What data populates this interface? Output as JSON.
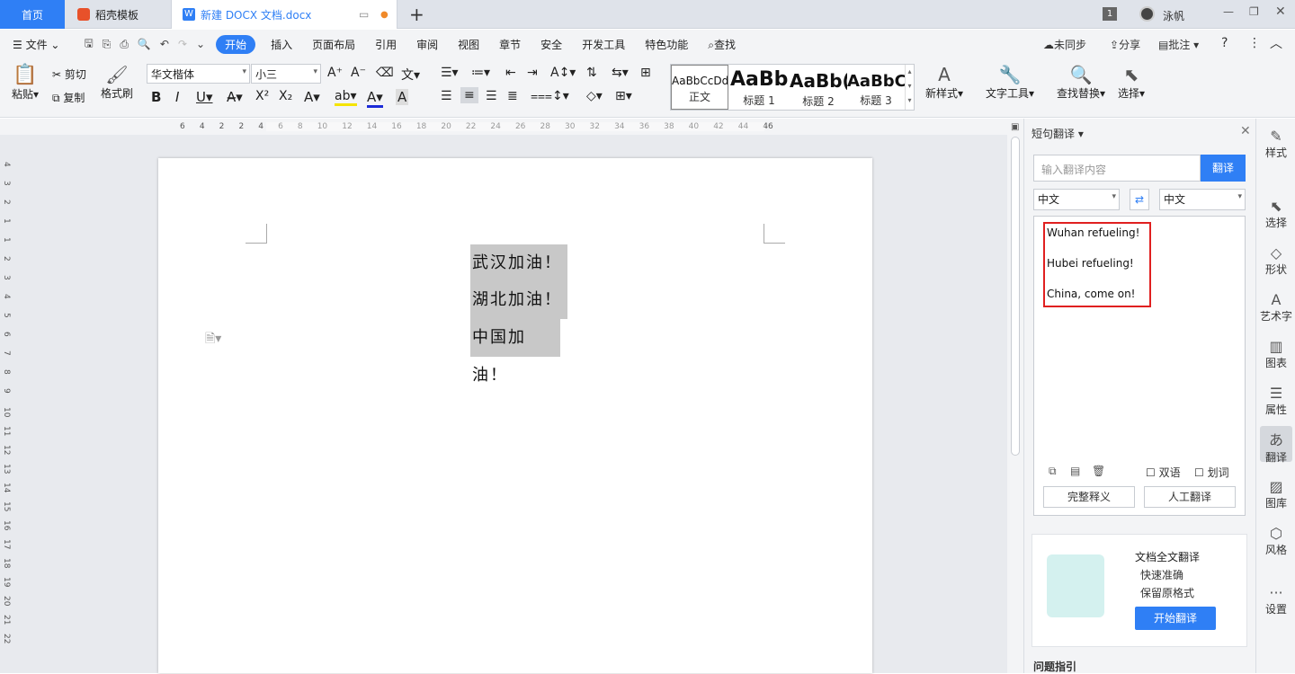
{
  "tabs": {
    "home": "首页",
    "template": "稻壳模板",
    "doc": "新建 DOCX 文档.docx",
    "user": "泳帆",
    "badge": "1"
  },
  "menu": {
    "file": "文件",
    "items": [
      "开始",
      "插入",
      "页面布局",
      "引用",
      "审阅",
      "视图",
      "章节",
      "安全",
      "开发工具",
      "特色功能",
      "查找"
    ],
    "sync": "未同步",
    "share": "分享",
    "comment": "批注"
  },
  "toolbar": {
    "paste": "粘贴",
    "cut": "剪切",
    "copy": "复制",
    "format_painter": "格式刷",
    "font": "华文楷体",
    "size": "小三",
    "styles": [
      {
        "preview": "AaBbCcDd",
        "label": "正文"
      },
      {
        "preview": "AaBb",
        "label": "标题 1"
      },
      {
        "preview": "AaBb(",
        "label": "标题 2"
      },
      {
        "preview": "AaBbC(",
        "label": "标题 3"
      }
    ],
    "new_style": "新样式",
    "text_tools": "文字工具",
    "find_replace": "查找替换",
    "select": "选择"
  },
  "ruler": {
    "top_marks": [
      "6",
      "4",
      "2",
      "2",
      "4",
      "6",
      "8",
      "10",
      "12",
      "14",
      "16",
      "18",
      "20",
      "22",
      "24",
      "26",
      "28",
      "30",
      "32",
      "34",
      "36",
      "38",
      "40",
      "42",
      "44",
      "46"
    ],
    "left_marks": [
      "4",
      "3",
      "2",
      "1",
      "1",
      "2",
      "3",
      "4",
      "5",
      "6",
      "7",
      "8",
      "9",
      "10",
      "11",
      "12",
      "13",
      "14",
      "15",
      "16",
      "17",
      "18",
      "19",
      "20",
      "21",
      "22"
    ]
  },
  "document": {
    "lines": [
      "武汉加油！",
      "湖北加油！",
      "中国加油！"
    ]
  },
  "panel": {
    "title": "短句翻译",
    "input_placeholder": "输入翻译内容",
    "translate_button": "翻译",
    "source_lang": "中文",
    "target_lang": "中文",
    "results": [
      "Wuhan refueling!",
      "Hubei refueling!",
      "China, come on!"
    ],
    "bilingual": "双语",
    "word_pick": "划词",
    "full_def": "完整释义",
    "human_translate": "人工翻译",
    "promo_title": "文档全文翻译",
    "promo_line2": "快速准确",
    "promo_line3": "保留原格式",
    "promo_button": "开始翻译",
    "help_title": "问题指引"
  },
  "rightbar": [
    "样式",
    "选择",
    "形状",
    "艺术字",
    "图表",
    "属性",
    "翻译",
    "图库",
    "风格",
    "设置"
  ],
  "colors": {
    "accent": "#2f7ff5",
    "highlight_red": "#e02020"
  }
}
